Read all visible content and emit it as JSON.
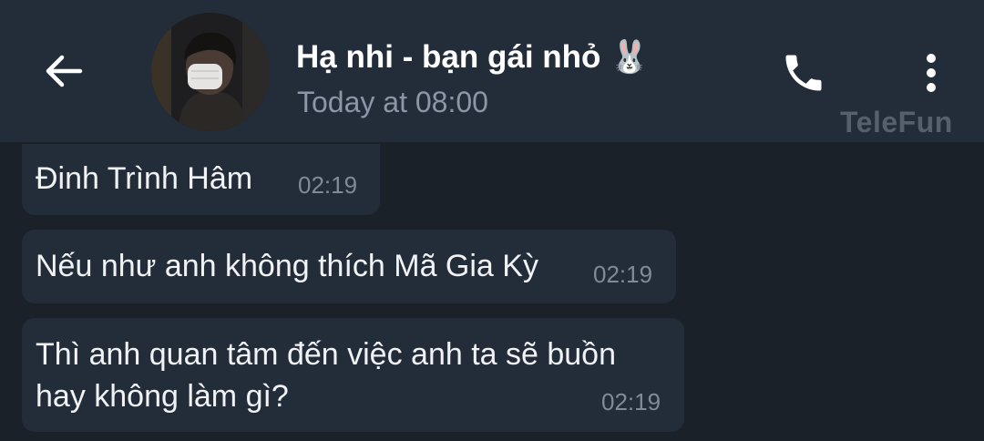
{
  "header": {
    "title": "Hạ nhi - bạn gái nhỏ 🐰",
    "status": "Today at 08:00",
    "back_icon": "arrow-left-icon",
    "call_icon": "phone-icon",
    "menu_icon": "more-vertical-icon",
    "watermark": "TeleFun"
  },
  "messages": [
    {
      "lines": [
        "Đinh Trình Hâm"
      ],
      "time": "02:19"
    },
    {
      "lines": [
        "Nếu như anh không thích Mã Gia Kỳ"
      ],
      "time": "02:19"
    },
    {
      "lines": [
        "Thì anh quan tâm đến việc anh ta sẽ buồn",
        "hay không làm gì?"
      ],
      "time": "02:19"
    }
  ],
  "colors": {
    "header_bg": "#232d3a",
    "chat_bg": "#1b2129",
    "bubble_bg": "#232d39",
    "text": "#f0f2f4",
    "muted": "#8b97a6"
  }
}
